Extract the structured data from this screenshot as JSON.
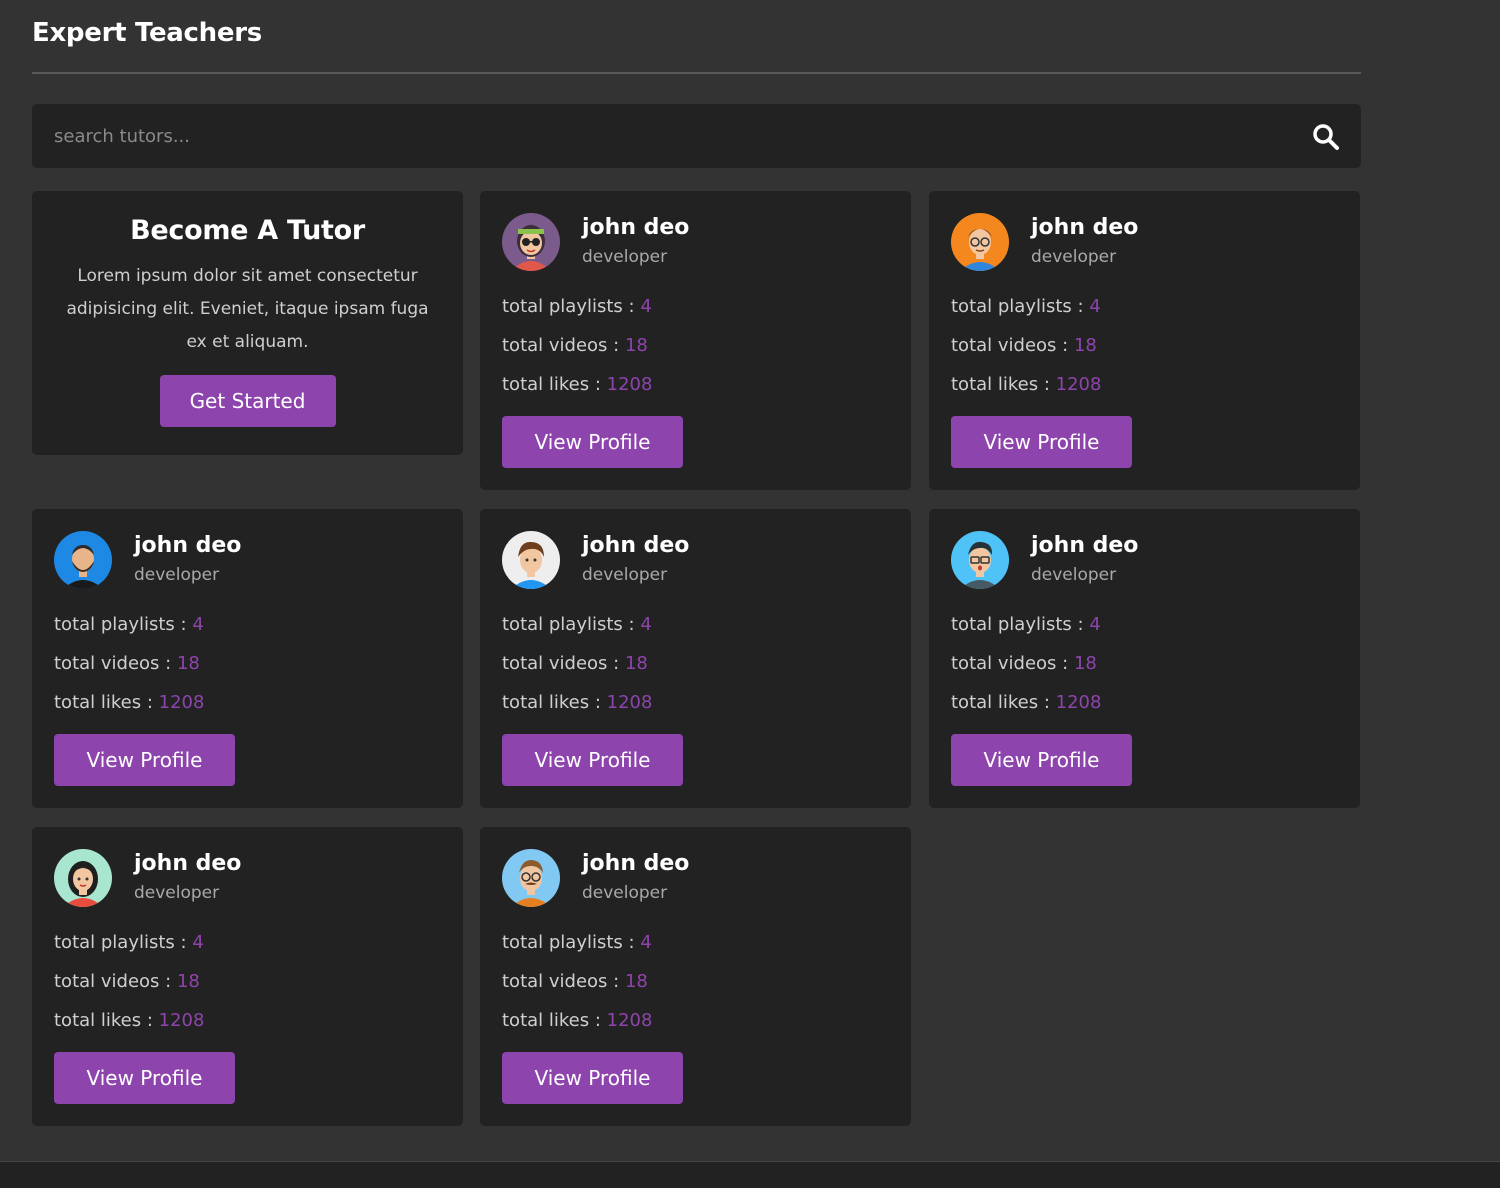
{
  "section": {
    "title": "Expert Teachers"
  },
  "search": {
    "placeholder": "search tutors..."
  },
  "become_tutor": {
    "title": "Become A Tutor",
    "text": "Lorem ipsum dolor sit amet consectetur adipisicing elit. Eveniet, itaque ipsam fuga ex et aliquam.",
    "button": "Get Started"
  },
  "labels": {
    "playlists": "total playlists : ",
    "videos": "total videos : ",
    "likes": "total likes : ",
    "button": "View Profile"
  },
  "teachers": [
    {
      "name": "john deo",
      "role": "developer",
      "playlists": "4",
      "videos": "18",
      "likes": "1208",
      "avatar": "avatar-woman-sunglasses"
    },
    {
      "name": "john deo",
      "role": "developer",
      "playlists": "4",
      "videos": "18",
      "likes": "1208",
      "avatar": "avatar-man-glasses-orange"
    },
    {
      "name": "john deo",
      "role": "developer",
      "playlists": "4",
      "videos": "18",
      "likes": "1208",
      "avatar": "avatar-man-beard-blue"
    },
    {
      "name": "john deo",
      "role": "developer",
      "playlists": "4",
      "videos": "18",
      "likes": "1208",
      "avatar": "avatar-boy-brown-hair"
    },
    {
      "name": "john deo",
      "role": "developer",
      "playlists": "4",
      "videos": "18",
      "likes": "1208",
      "avatar": "avatar-man-glasses-cyan"
    },
    {
      "name": "john deo",
      "role": "developer",
      "playlists": "4",
      "videos": "18",
      "likes": "1208",
      "avatar": "avatar-woman-black-hair"
    },
    {
      "name": "john deo",
      "role": "developer",
      "playlists": "4",
      "videos": "18",
      "likes": "1208",
      "avatar": "avatar-man-mustache-glasses"
    }
  ],
  "colors": {
    "accent": "#8e44ad",
    "card": "#222222",
    "background": "#333333"
  }
}
